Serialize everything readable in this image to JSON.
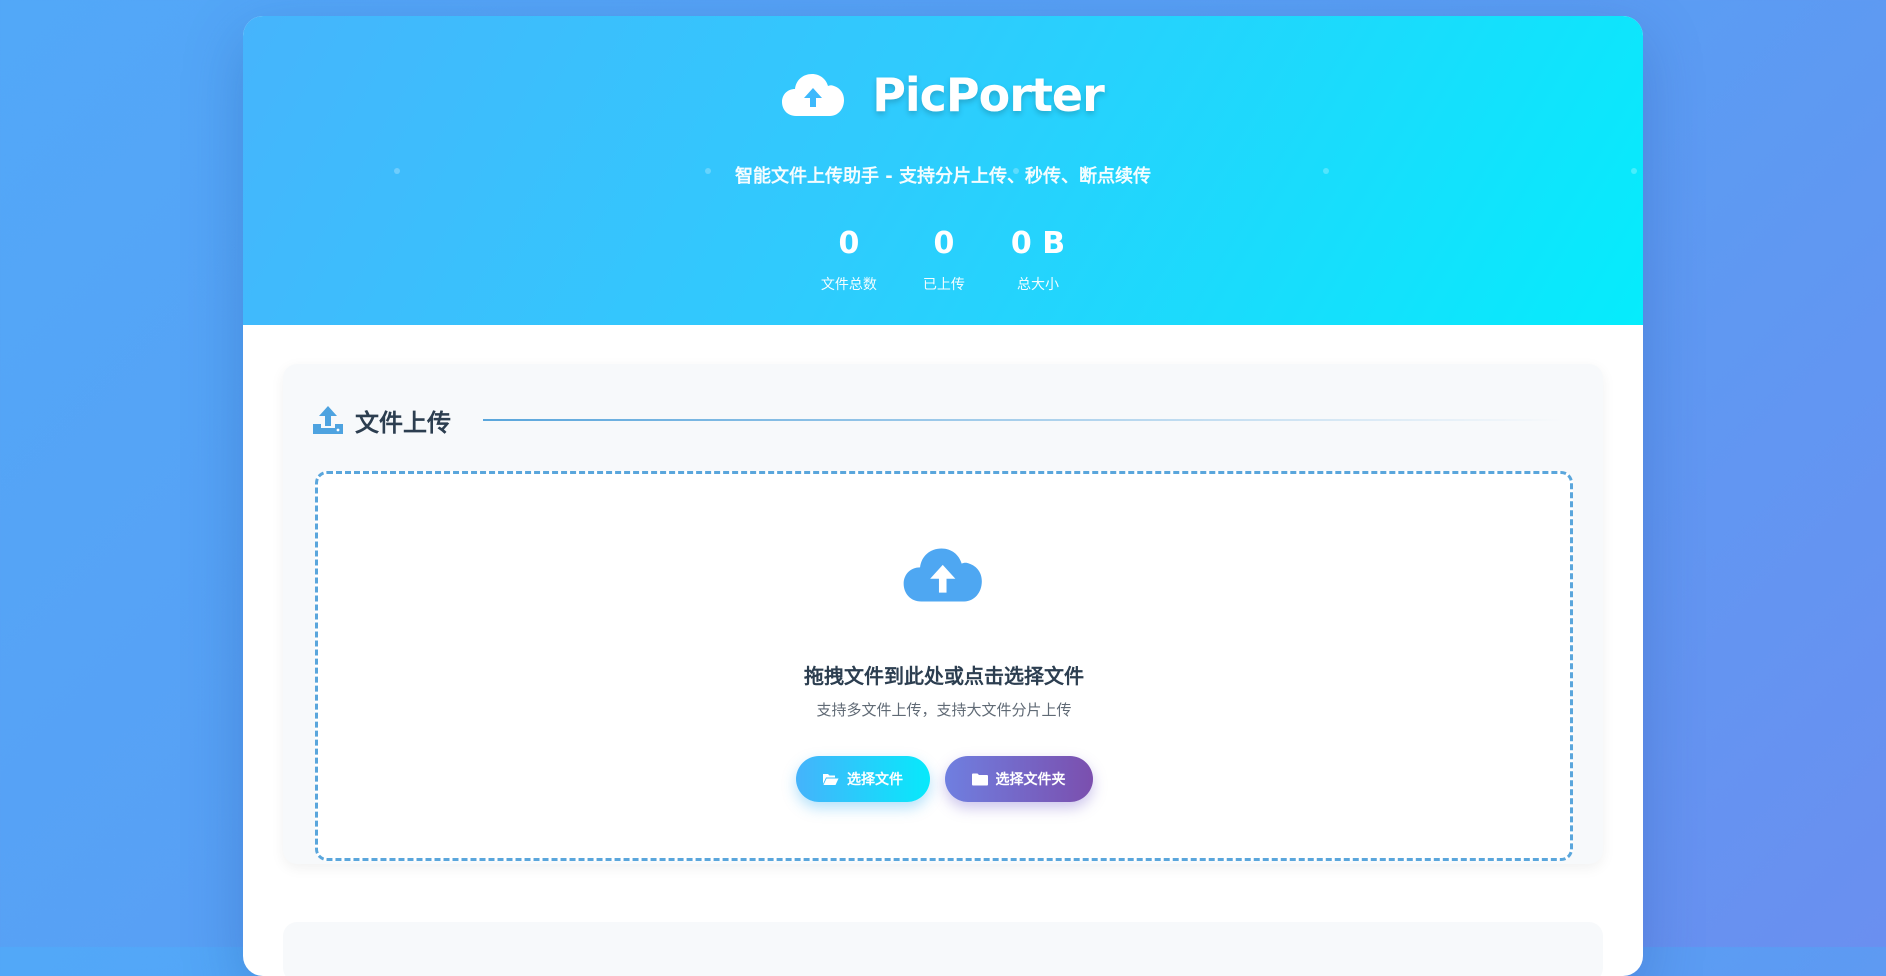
{
  "header": {
    "app_name": "PicPorter",
    "subtitle": "智能文件上传助手 - 支持分片上传、秒传、断点续传",
    "logo_icon": "cloud-upload-icon",
    "stats": [
      {
        "value": "0",
        "label": "文件总数"
      },
      {
        "value": "0",
        "label": "已上传"
      },
      {
        "value": "0 B",
        "label": "总大小"
      }
    ]
  },
  "upload_section": {
    "title": "文件上传",
    "icon": "upload-icon",
    "dropzone": {
      "icon": "cloud-upload-icon",
      "title": "拖拽文件到此处或点击选择文件",
      "hint": "支持多文件上传，支持大文件分片上传"
    },
    "buttons": {
      "select_files": {
        "label": "选择文件",
        "icon": "folder-open-icon"
      },
      "select_folder": {
        "label": "选择文件夹",
        "icon": "folder-icon"
      }
    }
  },
  "colors": {
    "hero_start": "#46b4fc",
    "hero_end": "#05ecfc",
    "accent": "#5aa6dc",
    "folder_button_start": "#6f7fe0",
    "folder_button_end": "#7b4fae",
    "text_dark": "#2c3e50"
  }
}
